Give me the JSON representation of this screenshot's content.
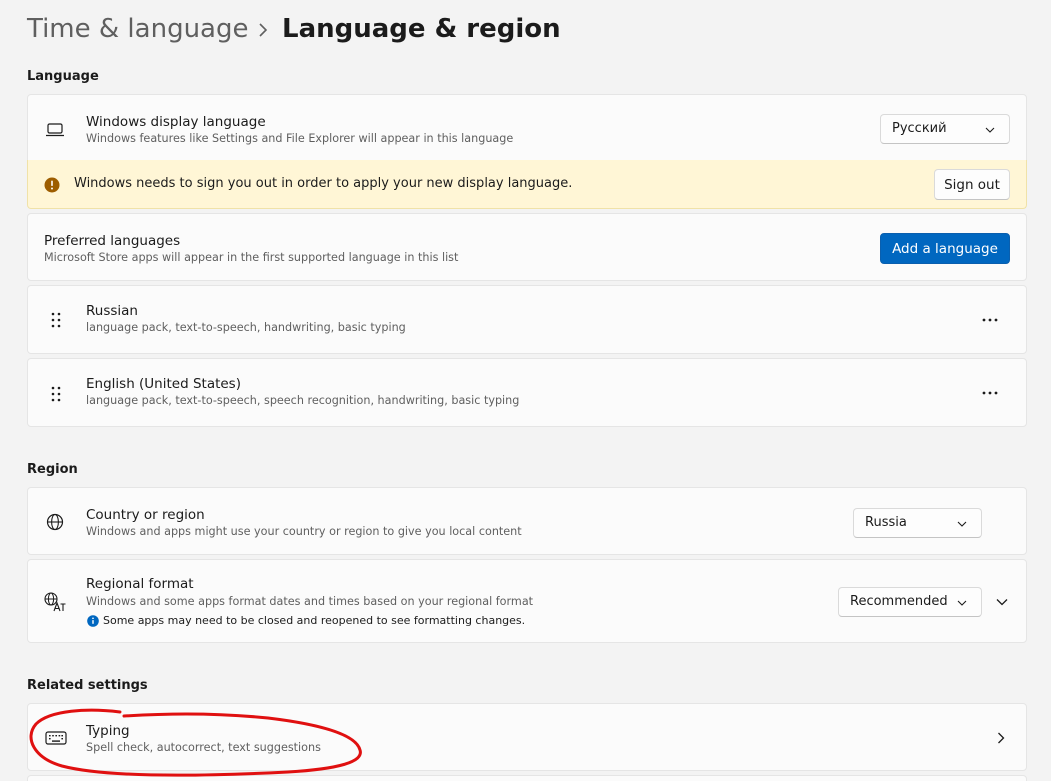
{
  "breadcrumb": {
    "parent": "Time & language",
    "separator_icon": "chevron-right-icon",
    "current": "Language & region"
  },
  "language_section": {
    "heading": "Language",
    "display_language": {
      "icon": "laptop-icon",
      "title": "Windows display language",
      "description": "Windows features like Settings and File Explorer will appear in this language",
      "selected": "Русский"
    },
    "signout_banner": {
      "icon": "warning-circle-icon",
      "message": "Windows needs to sign you out in order to apply your new display language.",
      "button": "Sign out",
      "background": "#fff6d6"
    },
    "preferred": {
      "title": "Preferred languages",
      "description": "Microsoft Store apps will appear in the first supported language in this list",
      "add_button": "Add a language"
    },
    "languages": [
      {
        "name": "Russian",
        "features": "language pack, text-to-speech, handwriting, basic typing",
        "menu_icon": "more-icon"
      },
      {
        "name": "English (United States)",
        "features": "language pack, text-to-speech, speech recognition, handwriting, basic typing",
        "menu_icon": "more-icon"
      }
    ]
  },
  "region_section": {
    "heading": "Region",
    "country": {
      "icon": "globe-icon",
      "title": "Country or region",
      "description": "Windows and apps might use your country or region to give you local content",
      "selected": "Russia"
    },
    "regional_format": {
      "icon": "language-format-icon",
      "title": "Regional format",
      "description": "Windows and some apps format dates and times based on your regional format",
      "note": "Some apps may need to be closed and reopened to see formatting changes.",
      "selected": "Recommended",
      "expand_icon": "chevron-down-icon"
    }
  },
  "related_section": {
    "heading": "Related settings",
    "typing": {
      "icon": "keyboard-icon",
      "title": "Typing",
      "description": "Spell check, autocorrect, text suggestions",
      "nav_icon": "chevron-right-icon"
    }
  },
  "colors": {
    "accent": "#0067c0",
    "annotation": "#e01010",
    "info": "#0067c0",
    "warning": "#9d5d00"
  }
}
